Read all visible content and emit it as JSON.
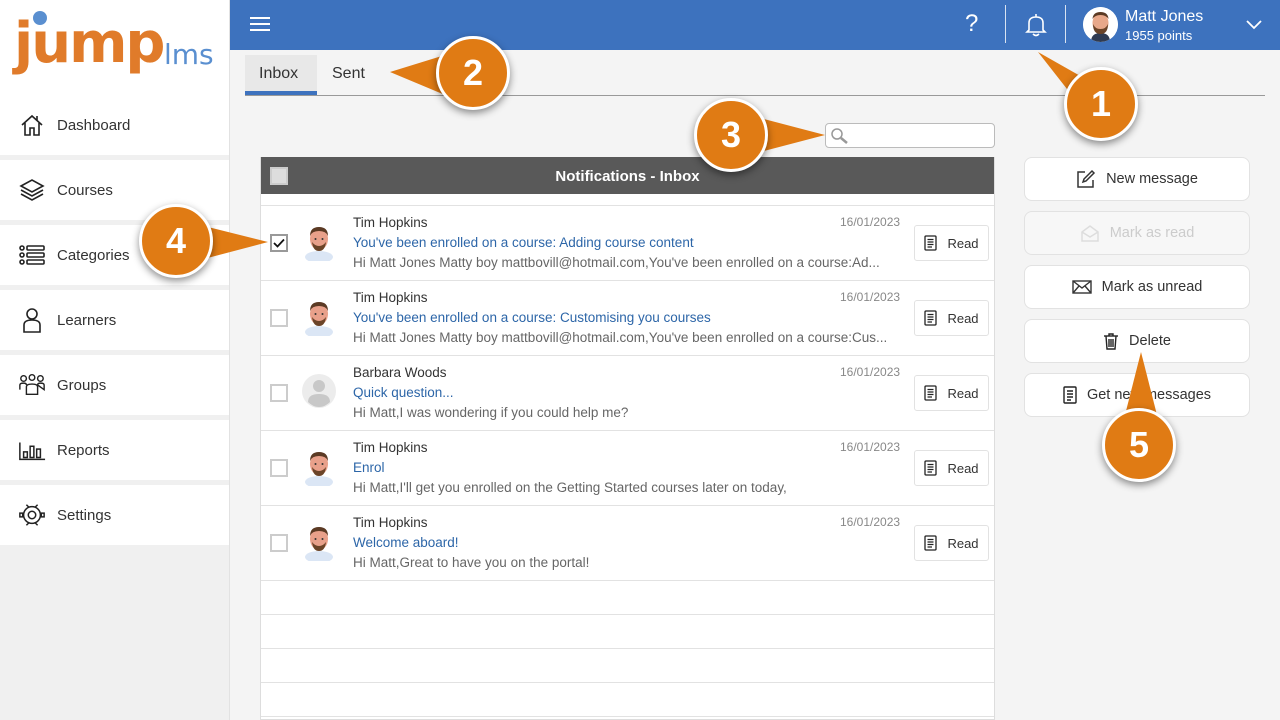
{
  "app": {
    "logo_main": "jump",
    "logo_sub": "lms"
  },
  "sidebar": {
    "items": [
      {
        "label": "Dashboard",
        "icon": "home-icon"
      },
      {
        "label": "Courses",
        "icon": "layers-icon"
      },
      {
        "label": "Categories",
        "icon": "list-icon"
      },
      {
        "label": "Learners",
        "icon": "user-icon"
      },
      {
        "label": "Groups",
        "icon": "group-icon"
      },
      {
        "label": "Reports",
        "icon": "bar-chart-icon"
      },
      {
        "label": "Settings",
        "icon": "gear-icon"
      }
    ]
  },
  "topbar": {
    "help_glyph": "?",
    "user_name": "Matt Jones",
    "user_points": "1955 points"
  },
  "tabs": [
    {
      "label": "Inbox",
      "active": true
    },
    {
      "label": "Sent",
      "active": false
    }
  ],
  "search": {
    "value": "",
    "placeholder": ""
  },
  "table": {
    "title": "Notifications - Inbox",
    "read_label": "Read",
    "rows": [
      {
        "sender": "Tim Hopkins",
        "subject": "You've been enrolled on a course: Adding course content",
        "preview": "Hi Matt Jones Matty boy mattbovill@hotmail.com,You've been enrolled on a course:Ad...",
        "date": "16/01/2023",
        "checked": true,
        "avatar": "male"
      },
      {
        "sender": "Tim Hopkins",
        "subject": "You've been enrolled on a course: Customising you courses",
        "preview": "Hi Matt Jones Matty boy mattbovill@hotmail.com,You've been enrolled on a course:Cus...",
        "date": "16/01/2023",
        "checked": false,
        "avatar": "male"
      },
      {
        "sender": "Barbara Woods",
        "subject": "Quick question...",
        "preview": "Hi Matt,I was wondering if you could help me?",
        "date": "16/01/2023",
        "checked": false,
        "avatar": "placeholder"
      },
      {
        "sender": "Tim Hopkins",
        "subject": "Enrol",
        "preview": "Hi Matt,I'll get you enrolled on the Getting Started courses later on today,",
        "date": "16/01/2023",
        "checked": false,
        "avatar": "male"
      },
      {
        "sender": "Tim Hopkins",
        "subject": "Welcome aboard!",
        "preview": "Hi Matt,Great to have you on the portal!",
        "date": "16/01/2023",
        "checked": false,
        "avatar": "male"
      }
    ]
  },
  "actions": [
    {
      "label": "New message",
      "icon": "compose-icon",
      "disabled": false
    },
    {
      "label": "Mark as read",
      "icon": "envelope-open-icon",
      "disabled": true
    },
    {
      "label": "Mark as unread",
      "icon": "envelope-icon",
      "disabled": false
    },
    {
      "label": "Delete",
      "icon": "trash-icon",
      "disabled": false
    },
    {
      "label": "Get new messages",
      "icon": "document-icon",
      "disabled": false
    }
  ],
  "callouts": [
    "1",
    "2",
    "3",
    "4",
    "5"
  ],
  "colors": {
    "topbar": "#3d72be",
    "accent_orange": "#e07b14",
    "table_header": "#595959",
    "link_blue": "#2d66a8"
  }
}
